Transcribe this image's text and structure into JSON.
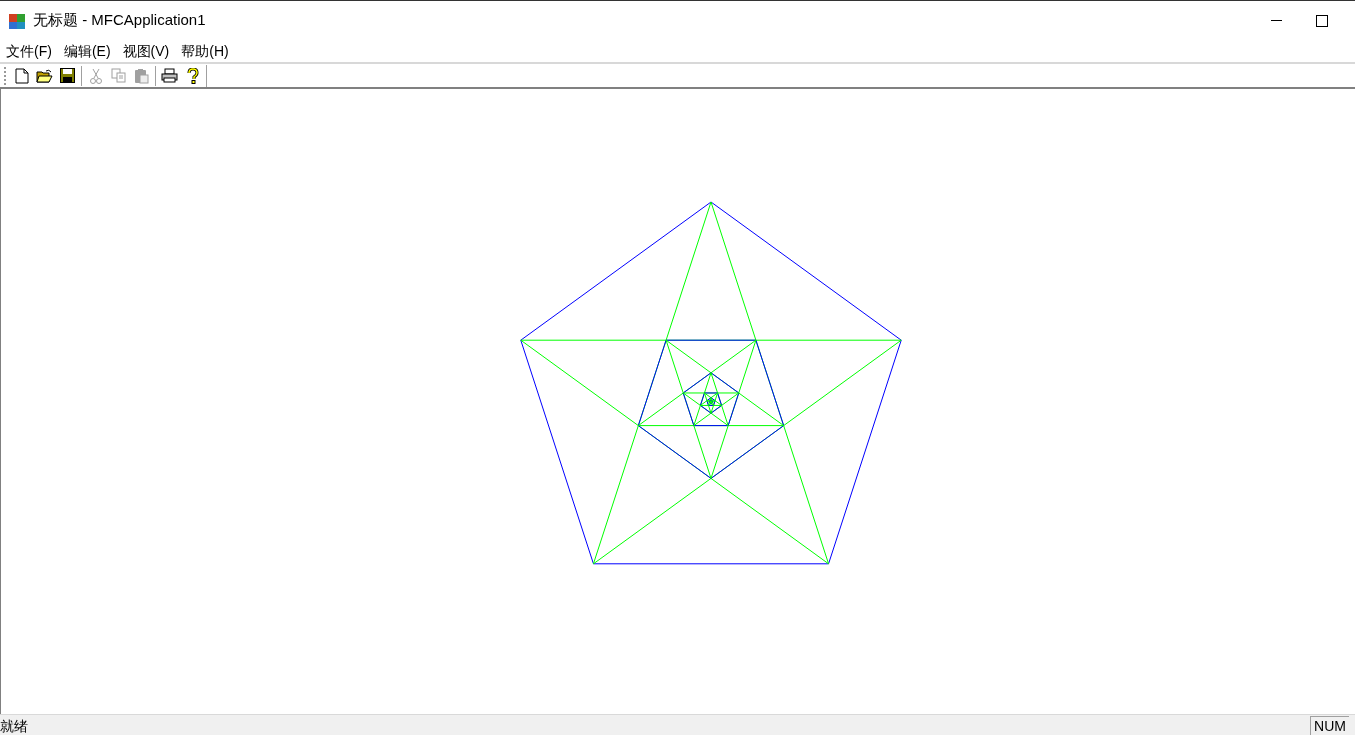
{
  "window": {
    "title": "无标题 - MFCApplication1"
  },
  "menu": [
    {
      "label": "文件(F)"
    },
    {
      "label": "编辑(E)"
    },
    {
      "label": "视图(V)"
    },
    {
      "label": "帮助(H)"
    }
  ],
  "toolbar": [
    {
      "kind": "new",
      "disabled": false
    },
    {
      "kind": "open",
      "disabled": false
    },
    {
      "kind": "save",
      "disabled": false
    },
    {
      "kind": "separator"
    },
    {
      "kind": "cut",
      "disabled": true
    },
    {
      "kind": "copy",
      "disabled": true
    },
    {
      "kind": "paste",
      "disabled": true
    },
    {
      "kind": "separator"
    },
    {
      "kind": "print",
      "disabled": false
    },
    {
      "kind": "help",
      "disabled": false
    }
  ],
  "status_bar": {
    "message": "就绪",
    "indicators": [
      "NUM"
    ]
  }
}
